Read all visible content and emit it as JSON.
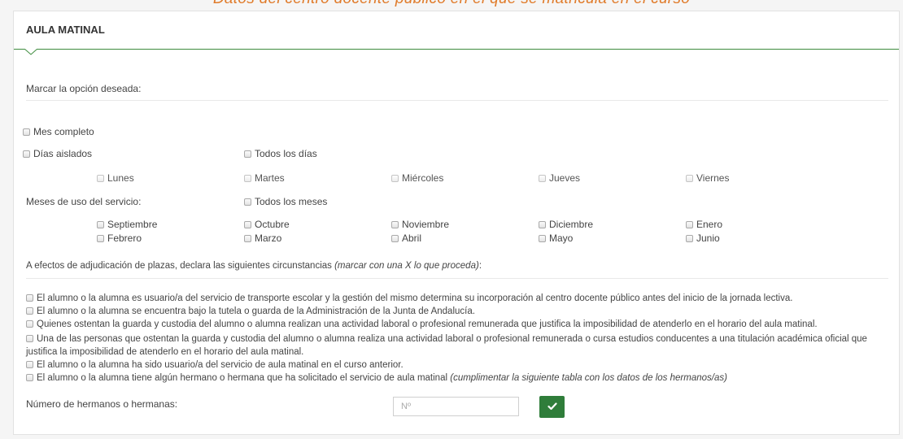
{
  "top_heading": "Datos del centro docente público en el que se matricula en el curso",
  "panel": {
    "title": "AULA MATINAL",
    "instruction": "Marcar la opción deseada:"
  },
  "options": {
    "mes_completo": "Mes completo",
    "dias_aislados": "Días aislados",
    "todos_los_dias": "Todos los días",
    "days": [
      "Lunes",
      "Martes",
      "Miércoles",
      "Jueves",
      "Viernes"
    ],
    "meses_label": "Meses de uso del servicio:",
    "todos_los_meses": "Todos los meses",
    "months_row1": [
      "Septiembre",
      "Octubre",
      "Noviembre",
      "Diciembre",
      "Enero"
    ],
    "months_row2": [
      "Febrero",
      "Marzo",
      "Abril",
      "Mayo",
      "Junio"
    ]
  },
  "circumstances": {
    "intro": "A efectos de adjudicación de plazas, declara las siguientes circunstancias ",
    "intro_note": "(marcar con una X lo que proceda)",
    "intro_end": ":",
    "items": [
      "El alumno o la alumna es usuario/a del servicio de transporte escolar y la gestión del mismo determina su incorporación al centro docente público antes del inicio de la jornada lectiva.",
      "El alumno o la alumna se encuentra bajo la tutela o guarda de la Administración de la Junta de Andalucía.",
      "Quienes ostentan la guarda y custodia del alumno o alumna realizan una actividad laboral o profesional remunerada que justifica la imposibilidad de atenderlo en el horario del aula matinal.",
      "Una de las personas que ostentan la guarda y custodia del alumno o alumna realiza una actividad laboral o profesional remunerada o cursa estudios conducentes a una titulación académica oficial que justifica la imposibilidad de atenderlo en el horario del aula matinal.",
      "El alumno o la alumna ha sido usuario/a del servicio de aula matinal en el curso anterior.",
      "El alumno o la alumna tiene algún hermano o hermana que ha solicitado el servicio de aula matinal "
    ],
    "last_note": "(cumplimentar la siguiente tabla con los datos de los hermanos/as)"
  },
  "siblings": {
    "label": "Número de hermanos o hermanas:",
    "placeholder": "Nº",
    "value": ""
  },
  "colors": {
    "accent_green": "#2f7d3a",
    "heading_orange": "#e07b2a"
  }
}
